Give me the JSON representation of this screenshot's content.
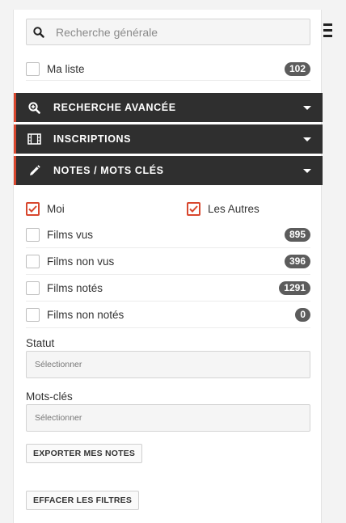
{
  "search": {
    "placeholder": "Recherche générale",
    "icon": "search-icon"
  },
  "my_list": {
    "label": "Ma liste",
    "count": "102"
  },
  "sections": [
    {
      "title": "RECHERCHE AVANCÉE",
      "icon": "zoom-in-icon"
    },
    {
      "title": "INSCRIPTIONS",
      "icon": "film-icon"
    },
    {
      "title": "NOTES / MOTS CLÉS",
      "icon": "pencil-icon"
    }
  ],
  "owners": [
    {
      "label": "Moi",
      "checked": true
    },
    {
      "label": "Les Autres",
      "checked": true
    }
  ],
  "filters": [
    {
      "label": "Films vus",
      "count": "895"
    },
    {
      "label": "Films non vus",
      "count": "396"
    },
    {
      "label": "Films notés",
      "count": "1291"
    },
    {
      "label": "Films non notés",
      "count": "0"
    }
  ],
  "statut": {
    "label": "Statut",
    "value": "Sélectionner"
  },
  "mots_cles": {
    "label": "Mots-clés",
    "value": "Sélectionner"
  },
  "buttons": {
    "export": "EXPORTER MES NOTES",
    "clear": "EFFACER LES FILTRES"
  },
  "colors": {
    "accent": "#d8472e",
    "header_bg": "#2f2f2f",
    "badge_bg": "#5c5c5c"
  }
}
